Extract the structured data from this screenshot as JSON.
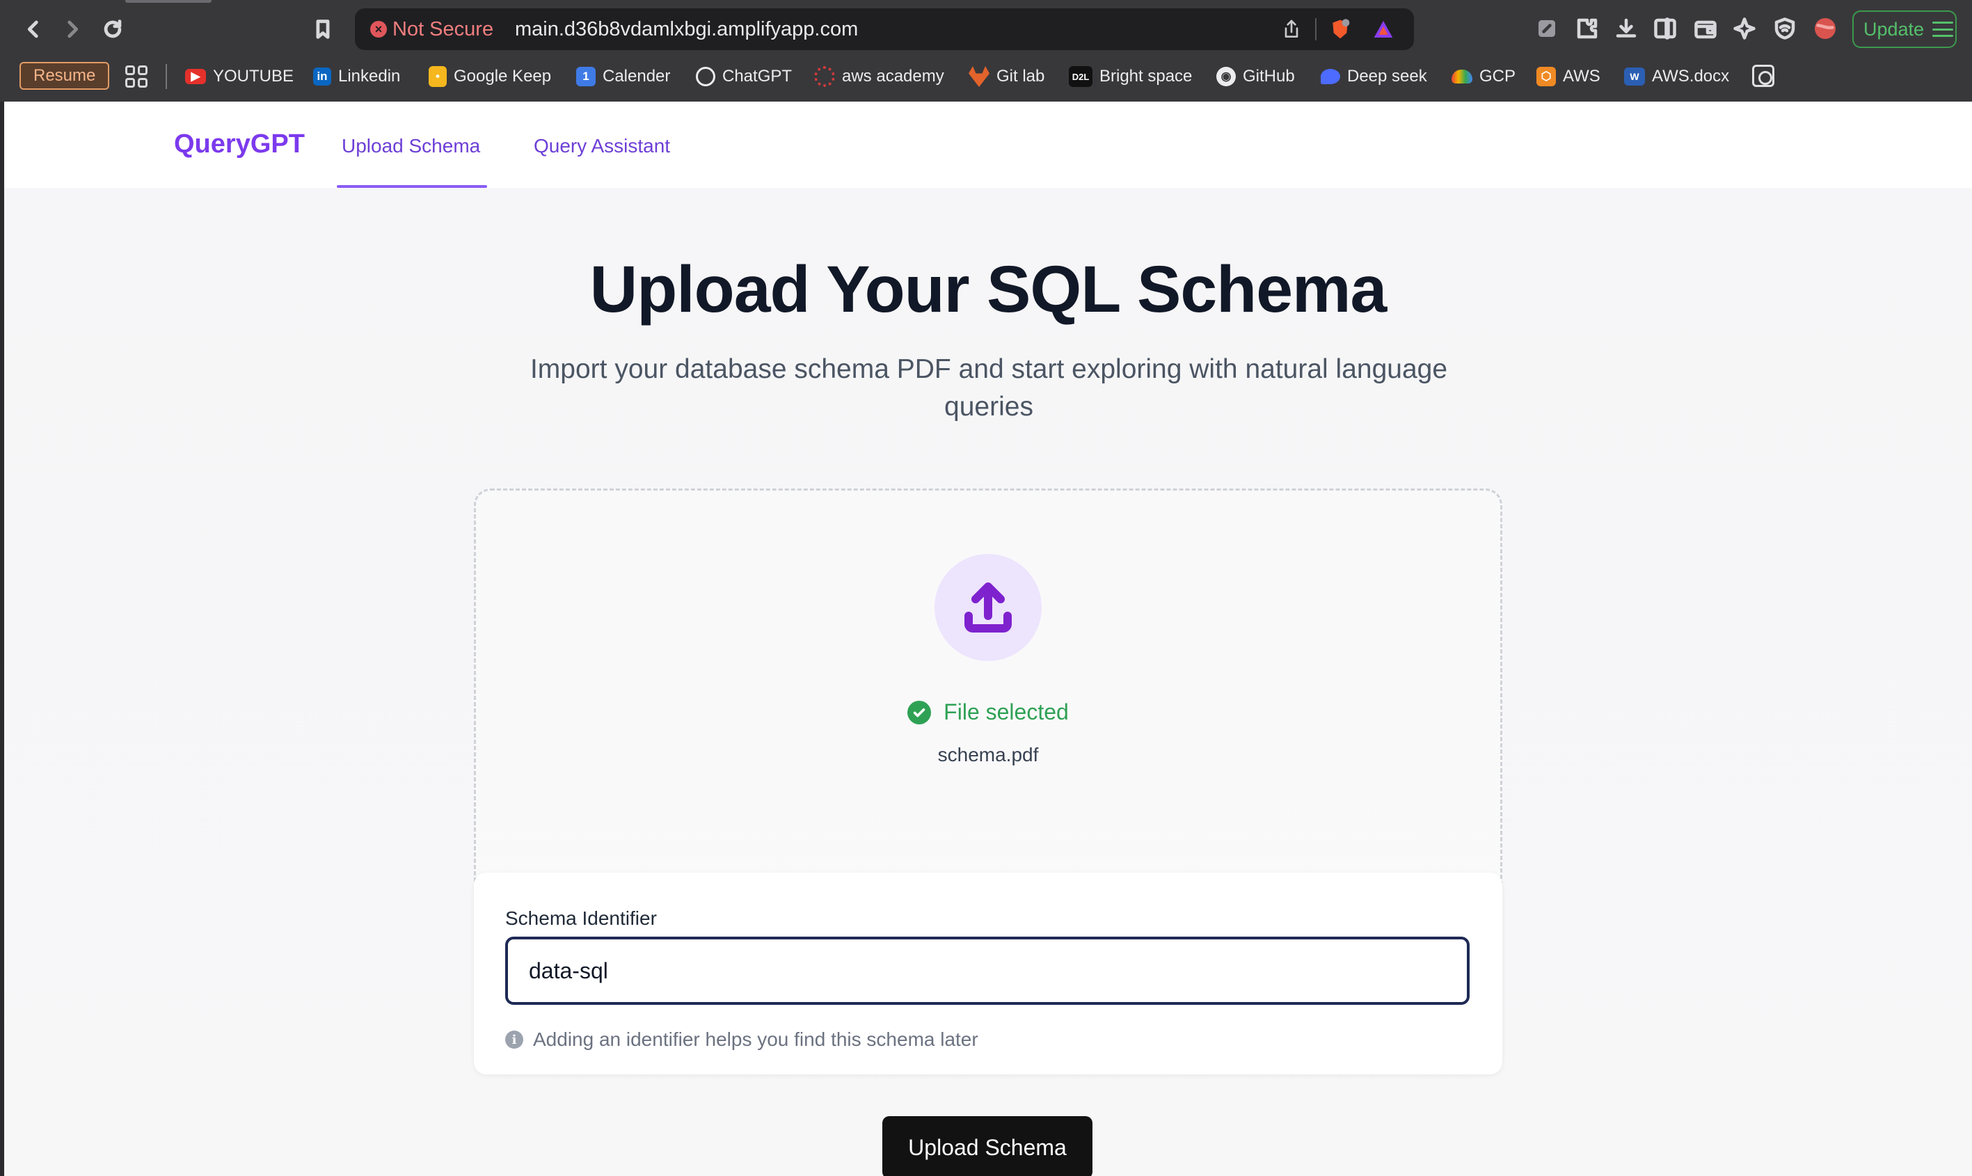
{
  "browser": {
    "url_security": "Not Secure",
    "url": "main.d36b8vdamlxbgi.amplifyapp.com",
    "update_label": "Update",
    "bookmarks": [
      {
        "label": "Resume"
      },
      {
        "label": "YOUTUBE",
        "icon": "youtube-icon",
        "color": "#e5312b"
      },
      {
        "label": "Linkedin",
        "icon": "linkedin-icon",
        "color": "#0a66c2"
      },
      {
        "label": "Google Keep",
        "icon": "keep-icon",
        "color": "#f5b71d"
      },
      {
        "label": "Calender",
        "icon": "calendar-icon",
        "color": "#3f7be6"
      },
      {
        "label": "ChatGPT",
        "icon": "chatgpt-icon",
        "color": "#ececef"
      },
      {
        "label": "aws academy",
        "icon": "aws-academy-icon",
        "color": "#d13a3a"
      },
      {
        "label": "Git lab",
        "icon": "gitlab-icon",
        "color": "#e2632b"
      },
      {
        "label": "Bright space",
        "icon": "d2l-icon",
        "color": "#111111"
      },
      {
        "label": "GitHub",
        "icon": "github-icon",
        "color": "#ececef"
      },
      {
        "label": "Deep seek",
        "icon": "deepseek-icon",
        "color": "#4d6bfe"
      },
      {
        "label": "GCP",
        "icon": "gcp-icon",
        "color": "#f4b400"
      },
      {
        "label": "AWS",
        "icon": "aws-icon",
        "color": "#f08a24"
      },
      {
        "label": "AWS.docx",
        "icon": "word-icon",
        "color": "#2b5fb4"
      }
    ]
  },
  "app": {
    "brand": "QueryGPT",
    "tabs": [
      {
        "label": "Upload Schema",
        "active": true
      },
      {
        "label": "Query Assistant",
        "active": false
      }
    ],
    "accent_color": "#7c3aed"
  },
  "hero": {
    "title": "Upload Your SQL Schema",
    "subtitle": "Import your database schema PDF and start exploring with natural language queries"
  },
  "dropzone": {
    "status": "File selected",
    "file_name": "schema.pdf",
    "status_color": "#2fa155"
  },
  "schema_form": {
    "label": "Schema Identifier",
    "value": "data-sql",
    "hint": "Adding an identifier helps you find this schema later"
  },
  "submit": {
    "label": "Upload Schema"
  }
}
